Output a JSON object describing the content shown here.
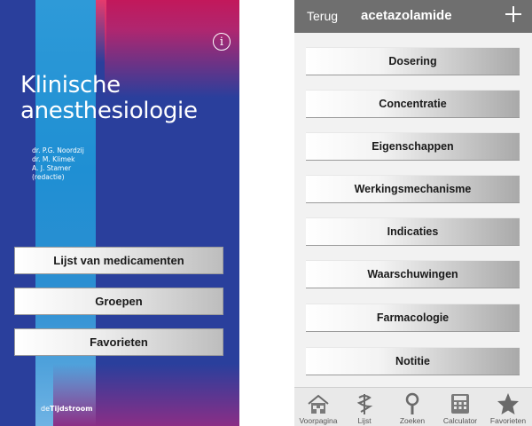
{
  "home": {
    "title_line1": "Klinische",
    "title_line2": "anesthesiologie",
    "authors": [
      "dr. P.G. Noordzij",
      "dr. M. Klimek",
      "A. J. Stamer",
      "(redactie)"
    ],
    "buttons": [
      "Lijst van medicamenten",
      "Groepen",
      "Favorieten"
    ],
    "publisher_prefix": "de",
    "publisher_name": "Tijdstroom",
    "info_icon": "i"
  },
  "detail": {
    "back_label": "Terug",
    "title": "acetazolamide",
    "sections": [
      "Dosering",
      "Concentratie",
      "Eigenschappen",
      "Werkingsmechanisme",
      "Indicaties",
      "Waarschuwingen",
      "Farmacologie",
      "Notitie"
    ]
  },
  "tabbar": {
    "items": [
      {
        "label": "Voorpagina",
        "icon": "home-icon"
      },
      {
        "label": "Lijst",
        "icon": "caduceus-icon"
      },
      {
        "label": "Zoeken",
        "icon": "magnifier-icon"
      },
      {
        "label": "Calculator",
        "icon": "calculator-icon"
      },
      {
        "label": "Favorieten",
        "icon": "star-icon"
      }
    ]
  },
  "colors": {
    "cover_blue": "#2a3f9c",
    "cover_light_blue": "#2e9ad8",
    "cover_pink": "#c2185b",
    "navbar_gray": "#6f6f6f"
  }
}
